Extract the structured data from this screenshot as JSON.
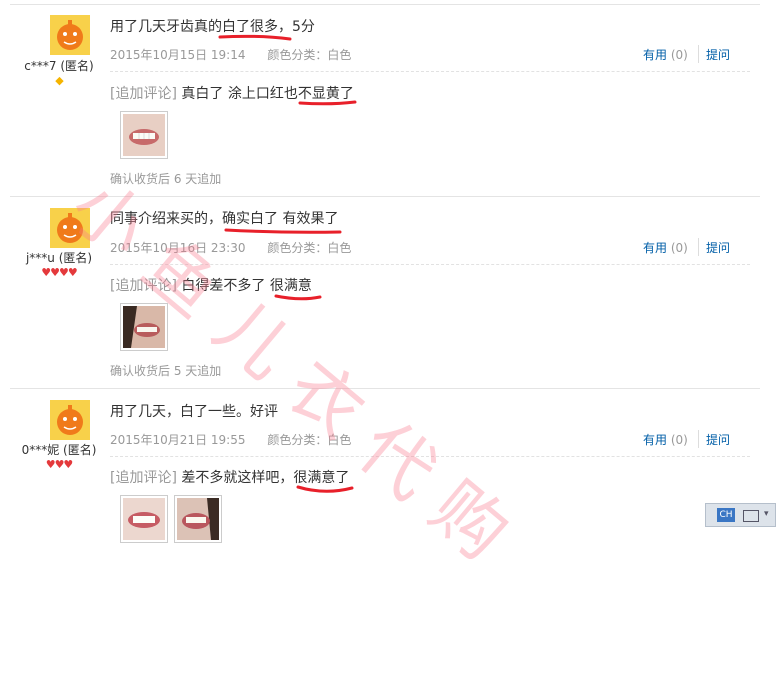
{
  "reviews": [
    {
      "user": "c***7 (匿名)",
      "badge": "◆",
      "text": "用了几天牙齿真的白了很多，5分",
      "date": "2015年10月15日 19:14",
      "color": "颜色分类：白色",
      "useful": "有用",
      "useful_count": "(0)",
      "ask": "提问",
      "append_tag": "[追加评论]",
      "append_text": "真白了 涂上口红也不显黄了",
      "confirm": "确认收货后 6 天追加"
    },
    {
      "user": "j***u (匿名)",
      "badge": "♥♥♥♥",
      "text": "同事介绍来买的，确实白了 有效果了",
      "date": "2015年10月16日 23:30",
      "color": "颜色分类：白色",
      "useful": "有用",
      "useful_count": "(0)",
      "ask": "提问",
      "append_tag": "[追加评论]",
      "append_text": "白得差不多了 很满意",
      "confirm": "确认收货后 5 天追加"
    },
    {
      "user": "0***妮 (匿名)",
      "badge": "♥♥♥",
      "text": "用了几天，白了一些。好评",
      "date": "2015年10月21日 19:55",
      "color": "颜色分类：白色",
      "useful": "有用",
      "useful_count": "(0)",
      "ask": "提问",
      "append_tag": "[追加评论]",
      "append_text": "差不多就这样吧，很满意了"
    }
  ],
  "watermark": "小鱼儿衣代购",
  "ime": {
    "label": "CH"
  }
}
